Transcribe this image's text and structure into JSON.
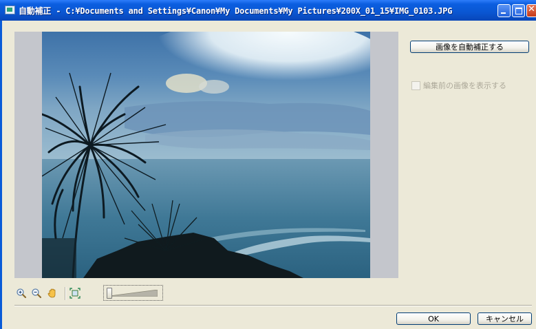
{
  "window": {
    "title": "自動補正 - C:¥Documents and Settings¥Canon¥My Documents¥My Pictures¥200X_01_15¥IMG_0103.JPG"
  },
  "panel": {
    "auto_correct_label": "画像を自動補正する",
    "show_original_label": "編集前の画像を表示する",
    "show_original_checked": false,
    "show_original_enabled": false
  },
  "toolbar": {
    "icons": [
      "zoom-in-icon",
      "zoom-out-icon",
      "hand-icon",
      "fit-to-window-icon"
    ],
    "zoom_slider_level": 0
  },
  "footer": {
    "ok_label": "OK",
    "cancel_label": "キャンセル"
  },
  "colors": {
    "titlebar": "#0a56d2",
    "dialog_bg": "#ece9d8",
    "preview_bg": "#c4c6cc",
    "disabled_text": "#aca899"
  }
}
